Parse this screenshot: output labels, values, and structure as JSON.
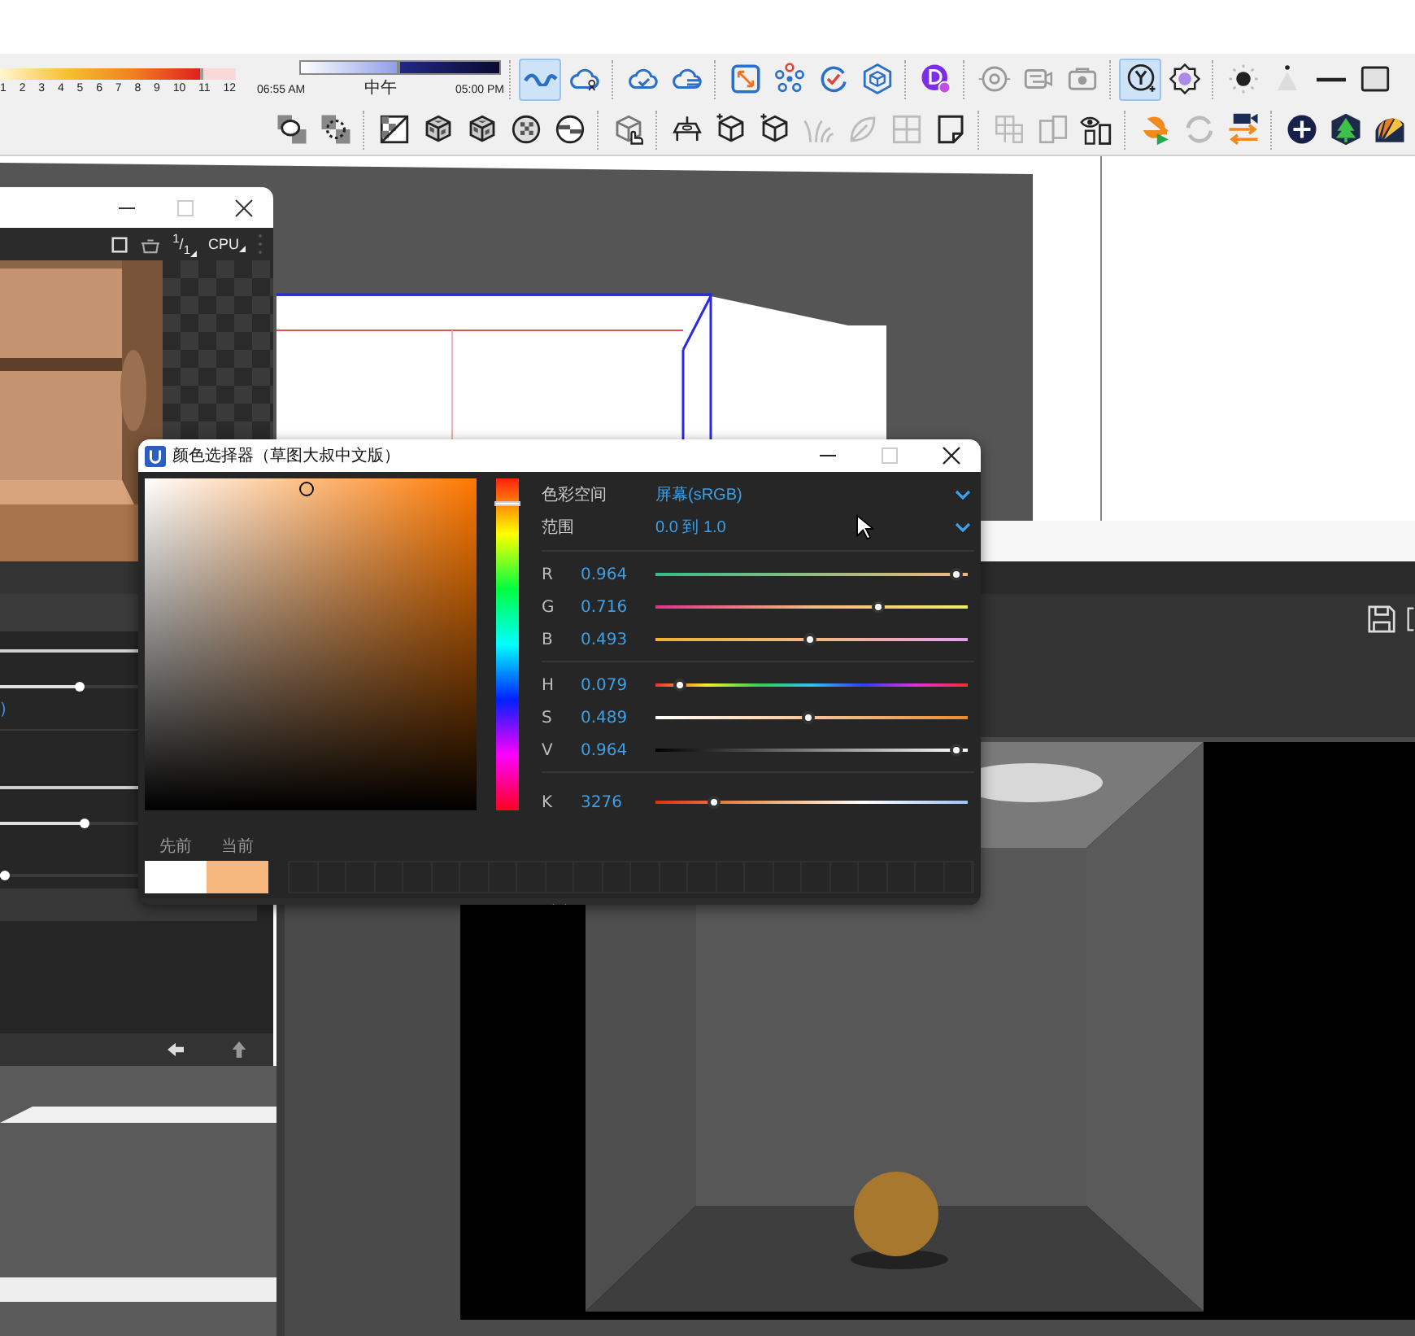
{
  "toolbar": {
    "month_slider": {
      "ticks": [
        "1",
        "2",
        "3",
        "4",
        "5",
        "6",
        "7",
        "8",
        "9",
        "10",
        "11",
        "12"
      ],
      "level": 0.86
    },
    "time_slider": {
      "start": "06:55 AM",
      "middle": "中午",
      "end": "05:00 PM",
      "level": 0.5
    },
    "row_1": [
      [
        {
          "kind": "cloud-wave",
          "selected": true
        },
        {
          "kind": "cloud-nodes",
          "selected": false
        }
      ],
      [
        {
          "kind": "cloud-check",
          "selected": false
        },
        {
          "kind": "cloud-lines",
          "selected": false
        }
      ],
      [
        {
          "kind": "frame",
          "selected": false
        },
        {
          "kind": "nodes",
          "selected": false
        },
        {
          "kind": "refresh-check",
          "selected": false
        },
        {
          "kind": "cube-hex",
          "selected": false
        }
      ],
      [
        {
          "kind": "purple-badge",
          "selected": false
        }
      ],
      [
        {
          "kind": "target",
          "selected": false
        },
        {
          "kind": "camera-swap",
          "selected": false
        },
        {
          "kind": "camera-box",
          "selected": false
        }
      ],
      [
        {
          "kind": "fork-circle",
          "selected": true
        },
        {
          "kind": "flower-gear",
          "selected": false
        }
      ],
      [
        {
          "kind": "sun",
          "selected": false
        },
        {
          "kind": "cone",
          "selected": false
        },
        {
          "kind": "dash",
          "selected": false
        },
        {
          "kind": "square",
          "selected": false
        }
      ]
    ],
    "row_2": [
      [
        {
          "kind": "sphere-square"
        },
        {
          "kind": "dots-square"
        }
      ],
      [
        {
          "kind": "checker-square"
        },
        {
          "kind": "cube-checker"
        },
        {
          "kind": "cube-checker"
        },
        {
          "kind": "checker-circle"
        },
        {
          "kind": "split-circle"
        }
      ],
      [
        {
          "kind": "hand-cube"
        }
      ],
      [
        {
          "kind": "table"
        },
        {
          "kind": "cube-spark"
        },
        {
          "kind": "cube-spark"
        },
        {
          "kind": "grass"
        },
        {
          "kind": "leaf"
        },
        {
          "kind": "window-grid"
        },
        {
          "kind": "page-fold"
        }
      ],
      [
        {
          "kind": "grid"
        },
        {
          "kind": "copy-pages"
        },
        {
          "kind": "eye-panel"
        }
      ],
      [
        {
          "kind": "e-logo"
        },
        {
          "kind": "refresh-gray"
        },
        {
          "kind": "swap-arrows"
        }
      ],
      [
        {
          "kind": "plus-circle"
        },
        {
          "kind": "tree-hex"
        },
        {
          "kind": "fan"
        }
      ]
    ]
  },
  "render_window": {
    "ratio": "$^{1}$/$_{1}$",
    "device": "CPU",
    "value_text": ")",
    "sliders": [
      {
        "level": 0.29
      },
      {
        "level": 0.31
      },
      {
        "level": 0.02
      }
    ]
  },
  "color_picker": {
    "title": "颜色选择器（草图大叔中文版）",
    "color_space_label": "色彩空间",
    "color_space_value": "屏幕(sRGB)",
    "range_label": "范围",
    "range_value": "0.0 到 1.0",
    "channel_groups": [
      [
        {
          "kind": "red",
          "label": "R",
          "value": "0.964",
          "level": 0.964
        },
        {
          "kind": "green",
          "label": "G",
          "value": "0.716",
          "level": 0.716
        },
        {
          "kind": "blue",
          "label": "B",
          "value": "0.493",
          "level": 0.493
        }
      ],
      [
        {
          "kind": "hue",
          "label": "H",
          "value": "0.079",
          "level": 0.079
        },
        {
          "kind": "saturation",
          "label": "S",
          "value": "0.489",
          "level": 0.489
        },
        {
          "kind": "value",
          "label": "V",
          "value": "0.964",
          "level": 0.964
        }
      ],
      [
        {
          "kind": "kelvin",
          "label": "K",
          "value": "3276",
          "level": 0.19
        }
      ]
    ],
    "previous_label": "先前",
    "current_label": "当前"
  }
}
